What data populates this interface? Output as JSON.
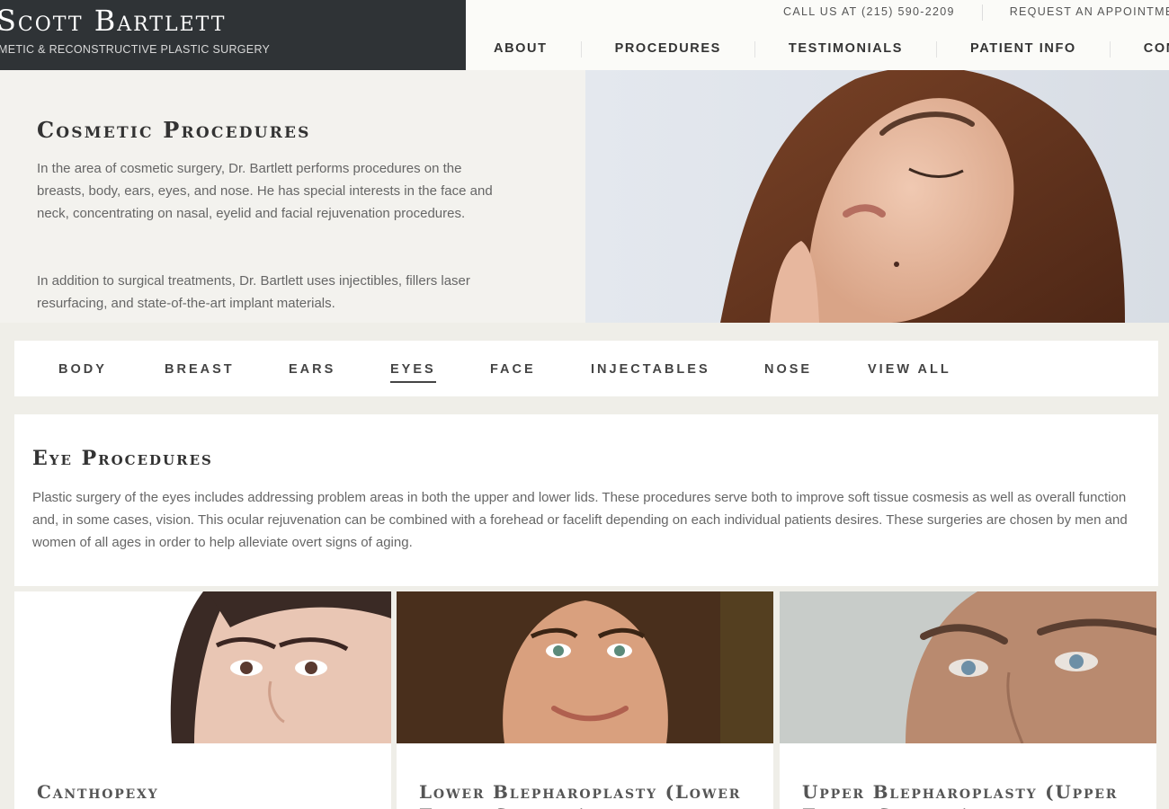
{
  "header": {
    "name": "Scott Bartlett",
    "tagline": "METIC & RECONSTRUCTIVE PLASTIC SURGERY",
    "call": "CALL US AT (215) 590-2209",
    "request": "REQUEST AN APPOINTMEN",
    "nav": [
      "ABOUT",
      "PROCEDURES",
      "TESTIMONIALS",
      "PATIENT INFO",
      "CONT"
    ]
  },
  "hero": {
    "title": "Cosmetic Procedures",
    "p1": "In the area of cosmetic surgery, Dr. Bartlett performs procedures on the breasts, body, ears, eyes, and nose.  He has special interests in the face and neck, concentrating on nasal, eyelid and facial rejuvenation procedures.",
    "p2": "In addition to surgical treatments, Dr. Bartlett uses injectibles, fillers laser resurfacing, and state-of-the-art implant materials."
  },
  "tabs": [
    "BODY",
    "BREAST",
    "EARS",
    "EYES",
    "FACE",
    "INJECTABLES",
    "NOSE",
    "VIEW ALL"
  ],
  "active_tab": "EYES",
  "intro": {
    "title": "Eye Procedures",
    "text": "Plastic surgery of the eyes includes addressing problem areas in both the upper and lower lids. These procedures serve both to improve soft tissue cosmesis as well as overall function and, in some cases, vision. This ocular rejuvenation can be combined with a forehead or facelift depending on each individual patients desires. These surgeries are chosen by men and women of all ages in order to help alleviate overt signs of aging."
  },
  "cards": [
    {
      "title": "Canthopexy"
    },
    {
      "title": "Lower Blepharoplasty (Lower Eyelid Surgery)"
    },
    {
      "title": "Upper Blepharoplasty (Upper Eyelid Surgery)"
    }
  ],
  "colors": {
    "header_dark": "#2f3336",
    "page_bg": "#efeee8",
    "text": "#666666"
  }
}
